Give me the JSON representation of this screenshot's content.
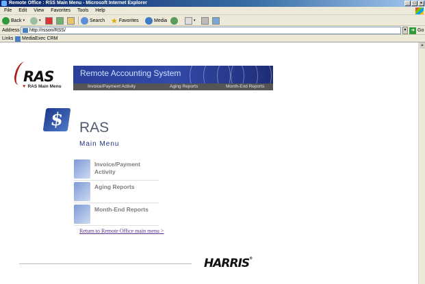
{
  "window": {
    "title": "Remote Office : RSS Main Menu - Microsoft Internet Explorer"
  },
  "menubar": [
    "File",
    "Edit",
    "View",
    "Favorites",
    "Tools",
    "Help"
  ],
  "toolbar": {
    "back": "Back",
    "search": "Search",
    "favorites": "Favorites",
    "media": "Media"
  },
  "address": {
    "label": "Address",
    "url": "http://rsson/RSS/",
    "go": "Go"
  },
  "links": {
    "label": "Links",
    "item": "MediaExec CRM"
  },
  "header": {
    "logo_text": "RAS",
    "banner_title": "Remote Accounting System",
    "nav": {
      "main": "RAS Main Menu",
      "invoice": "Invoice/Payment Activity",
      "aging": "Aging Reports",
      "monthend": "Month-End Reports"
    }
  },
  "main": {
    "title": "RAS",
    "subtitle": "Main Menu",
    "menu": [
      {
        "label": "Invoice/Payment Activity"
      },
      {
        "label": "Aging Reports"
      },
      {
        "label": "Month-End Reports"
      }
    ],
    "return_link": "Return to Remote Office main menu >"
  },
  "footer": {
    "brand": "HARRIS"
  }
}
